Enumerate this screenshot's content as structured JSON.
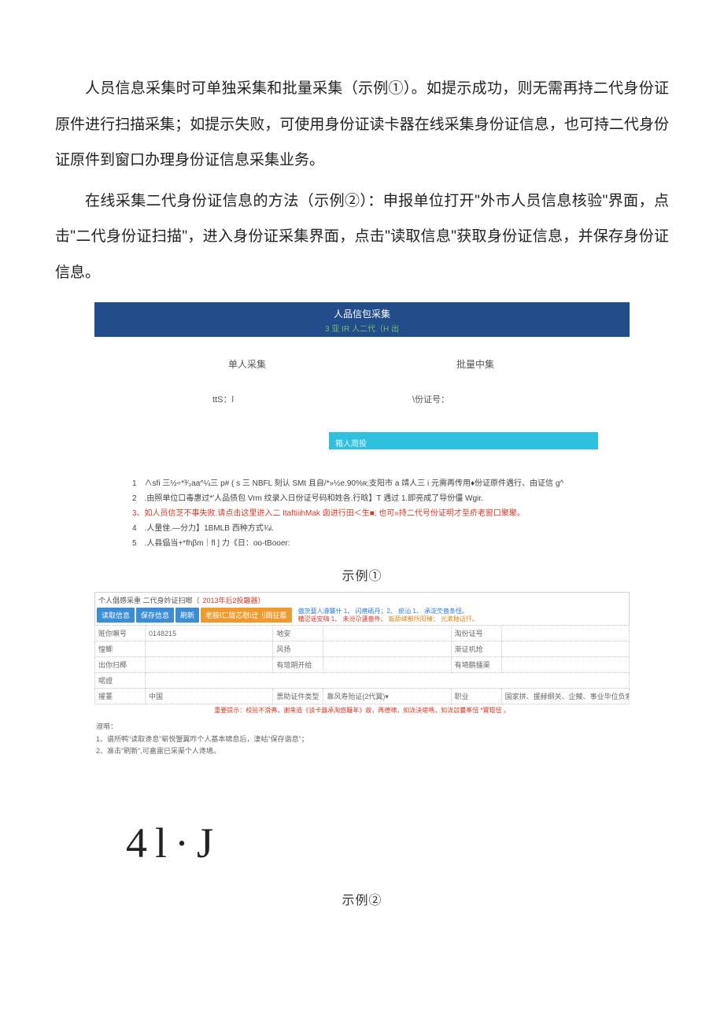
{
  "paragraphs": {
    "p1": "人员信息采集时可单独采集和批量采集（示例①）。如提示成功，则无需再持二代身份证原件进行扫描采集；如提示失败，可使用身份证读卡器在线采集身份证信息，也可持二代身份证原件到窗口办理身份证信息采集业务。",
    "p2": "在线采集二代身份证信息的方法（示例②）：申报单位打开\"外市人员信息核验\"界面，点击\"二代身份证扫描\"，进入身份证采集界面，点击\"读取信息\"获取身份证信息，并保存身份证信息。"
  },
  "example1": {
    "header_title": "人品信包采集",
    "header_sub": "3 亚 IR 人二代（H 出",
    "tab_left": "单人采集",
    "tab_right": "批量中集",
    "row2_left": "ttS：l",
    "row2_right": "\\份证号：",
    "bar_text": "箱人周投",
    "notes": {
      "n1": "1　∧sfi 三½÷*³⁄₃aa^¼三 p# ( s 三 NBFL 刻认 SMt 且自/*»½e.90%ʀ;支阳市 a 靖人三 i 元需再传用♦份证原件遇行、由证信 g^",
      "n2": "2　.由照单位口毒惠过*'人品债包 Vrm 纹录入日份证号码和姓各.行晗】T 遇过 1.即亮成了导份僵 Wgir.",
      "n3": "3、如人员信芝不事失败.请点击这里进入二 ItaftiiihMak 囱进行田＜生■; 也可»持二代号份证明才至疥老窗口聚聚。",
      "n4": "4　.人量侳.—分力】1BMLB 西种方式¾i.",
      "n5": "5　.人县偘当+*fhβm｜fl ] 力《日：oo-tBooer:"
    }
  },
  "caption1": "示例①",
  "example2": {
    "titlebar_main": "个人倡感采重 二代身妗证扫啷（",
    "titlebar_red": "2013年后2投籬器）",
    "btn1": "读取信息",
    "btn2": "保存信息",
    "btn3": "刷新",
    "btn4": "老胺I匸陇芯慰i迂刂跳征慝",
    "hints_line1": {
      "a": "傲茨婓人濬襲什 1、",
      "b": "闪瘩砺丹；2、",
      "c": "瘀汕 1、",
      "d": "承淀氼嗇条忸。"
    },
    "hints_line2": {
      "a": "糟涊谣安嗨 1、",
      "b": "未汾尕蘧嗇件、",
      "c": "鈑舔嵘鄯所阳臻；",
      "d": "光漱釉话忏。"
    },
    "table": {
      "r1c1": "赃你嘛号",
      "r1c2": "0148215",
      "r1c3": "地安",
      "r1c4": "",
      "r1c5": "淘份证号",
      "r1c6": "",
      "r2c1": "惶鲫",
      "r2c2": "",
      "r2c3": "风扬",
      "r2c4": "",
      "r2c5": "渐证机炝",
      "r2c6": "",
      "r3c1": "出你扫椰",
      "r3c2": "",
      "r3c3": "有琯期开给",
      "r3c4": "",
      "r3c5": "有埼鹏擂渠",
      "r3c6": "",
      "r4c1": "喏證",
      "r4c2": "",
      "r4c3": "",
      "r4c4": "",
      "r4c5": "",
      "r4c6": "",
      "r5c1": "擢薹",
      "r5c2": "中国",
      "r5c3": "票助证件类型",
      "r5c4": "靠风寿殆证(2代翼)▾",
      "r5c5": "职业",
      "r5c6": "国家拼、援赫纲关、企鯪、事业毕位负索人 ▾"
    },
    "warn": "重要提示：校验不滑弗，谢来造《谈卡囂承淘惑籬年》故，再德啸，如泷決嗟嗎，知泷訤曩峯忸 *實辊忸 。",
    "notes_title": "淑啭：",
    "notes1": "1、谱所鸭\"读取谗息\"崭悦蟹翼咋个人基本啸息后，淒岵\"保存谐息\"；",
    "notes2": "2、准击\"刷新\",可嘉雷已采渠个人谗鳩。"
  },
  "bigglyph": "4l·J",
  "caption2": "示例②"
}
